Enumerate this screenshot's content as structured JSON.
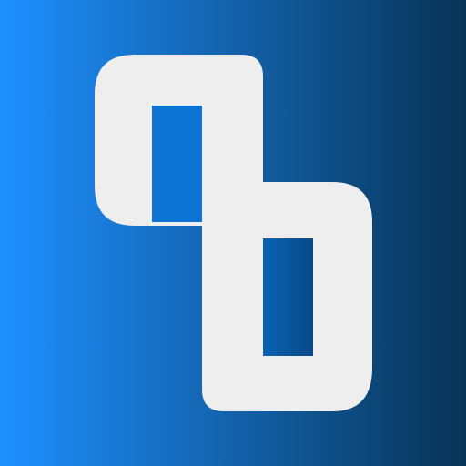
{
  "logo": {
    "icon": "qb-logo-icon",
    "text": "qb"
  },
  "colors": {
    "background_start": "#1E90FF",
    "background_end": "#083355",
    "glyph": "#EEEEEE",
    "counter_start": "#0A62B2",
    "counter_end": "#084A87"
  }
}
